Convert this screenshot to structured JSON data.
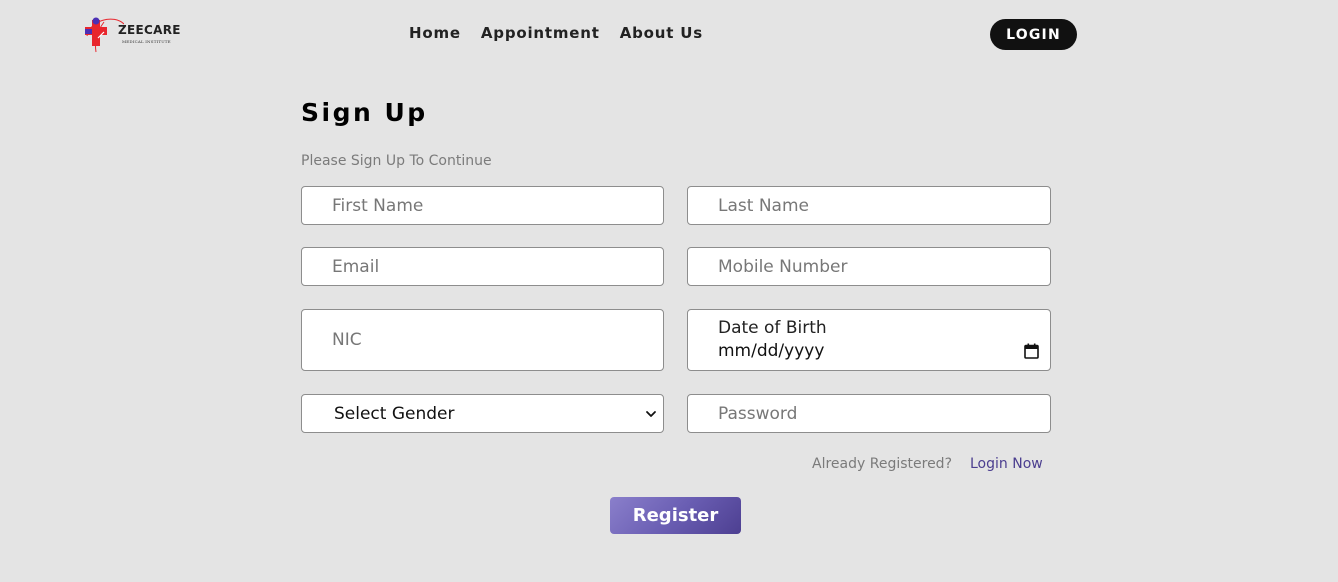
{
  "brand": {
    "name": "ZEECARE",
    "tagline": "MEDICAL INSTITUTE",
    "cross_color": "#e8262d",
    "accent_color": "#4b2fb5"
  },
  "nav": {
    "links": [
      "Home",
      "Appointment",
      "About Us"
    ],
    "login_label": "LOGIN"
  },
  "form": {
    "title": "Sign Up",
    "subtitle": "Please Sign Up To Continue",
    "first_name": {
      "placeholder": "First Name",
      "value": ""
    },
    "last_name": {
      "placeholder": "Last Name",
      "value": ""
    },
    "email": {
      "placeholder": "Email",
      "value": ""
    },
    "mobile": {
      "placeholder": "Mobile Number",
      "value": ""
    },
    "nic": {
      "placeholder": "NIC",
      "value": ""
    },
    "dob": {
      "label": "Date of Birth",
      "value": "mm/dd/yyyy",
      "icon": "calendar-icon"
    },
    "gender": {
      "selected": "Select Gender",
      "icon": "chevron-down-icon"
    },
    "password": {
      "placeholder": "Password",
      "value": ""
    },
    "already_registered": "Already Registered?",
    "login_now": "Login Now",
    "register_label": "Register"
  },
  "colors": {
    "background": "#e4e4e4",
    "login_button": "#111111",
    "register_gradient_start": "#8a7fcb",
    "register_gradient_end": "#4d3f91",
    "link": "#4b3e8f"
  }
}
